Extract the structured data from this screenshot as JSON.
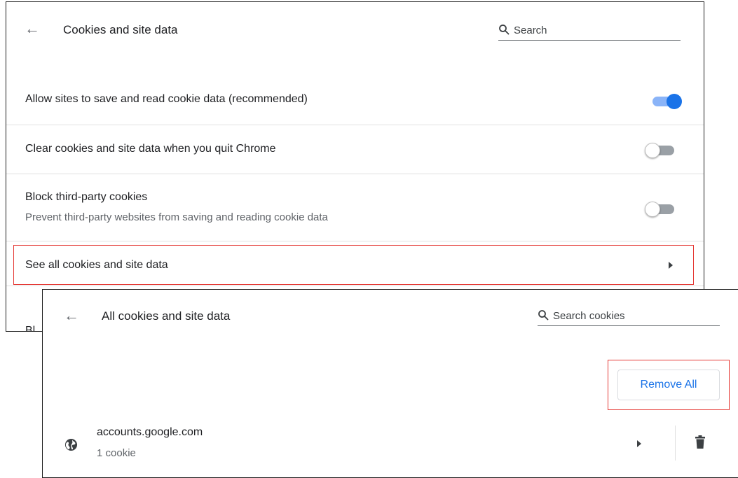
{
  "settings_page": {
    "back_glyph": "←",
    "title": "Cookies and site data",
    "search": {
      "placeholder": "Search",
      "icon": "search-icon"
    },
    "rows": [
      {
        "label": "Allow sites to save and read cookie data (recommended)",
        "toggle": "on"
      },
      {
        "label": "Clear cookies and site data when you quit Chrome",
        "toggle": "off"
      },
      {
        "label": "Block third-party cookies",
        "sublabel": "Prevent third-party websites from saving and reading cookie data",
        "toggle": "off"
      },
      {
        "label": "See all cookies and site data",
        "icon": "chevron-right-icon"
      }
    ],
    "partial_next_row": "Bl"
  },
  "cookies_page": {
    "back_glyph": "←",
    "title": "All cookies and site data",
    "search": {
      "placeholder": "Search cookies",
      "icon": "search-icon"
    },
    "remove_all_label": "Remove All",
    "sites": [
      {
        "domain": "accounts.google.com",
        "detail": "1 cookie",
        "icon": "globe-icon"
      }
    ]
  },
  "colors": {
    "accent": "#1a73e8",
    "toggle_on_track": "#8ab4f8",
    "toggle_off_track": "#9aa0a6",
    "highlight": "#e53935"
  }
}
